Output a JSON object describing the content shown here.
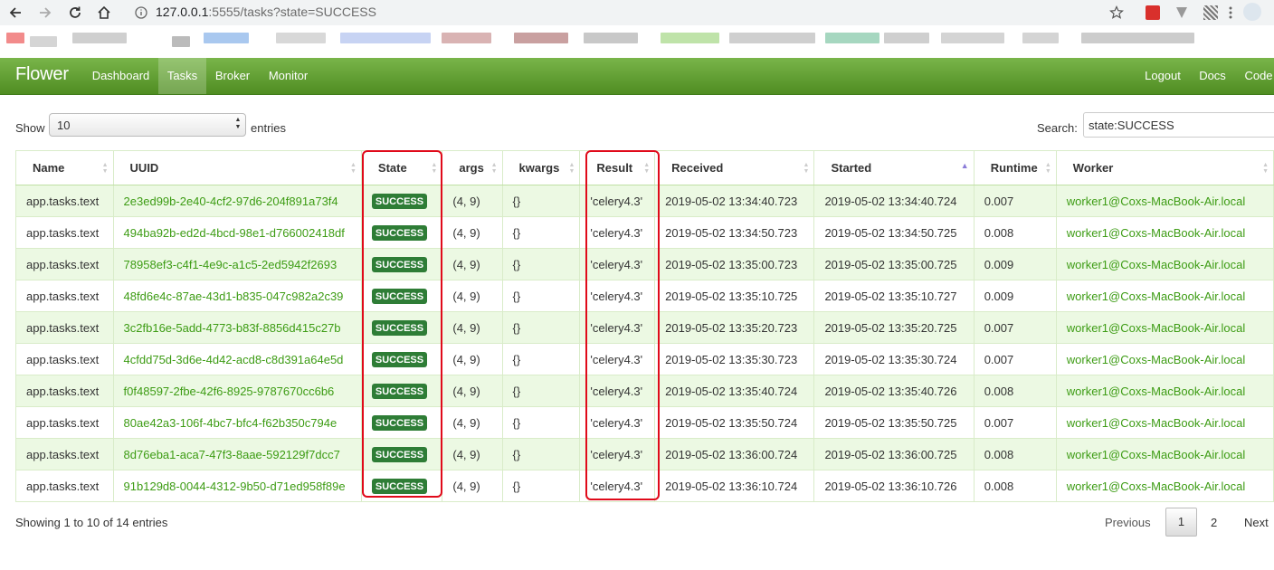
{
  "browser": {
    "url_host": "127.0.0.1",
    "url_rest": ":5555/tasks?state=SUCCESS"
  },
  "navbar": {
    "brand": "Flower",
    "links": [
      "Dashboard",
      "Tasks",
      "Broker",
      "Monitor"
    ],
    "right_links": [
      "Logout",
      "Docs",
      "Code"
    ]
  },
  "controls": {
    "show_label": "Show",
    "length_value": "10",
    "entries_label": "entries",
    "search_label": "Search:",
    "search_value": "state:SUCCESS"
  },
  "table": {
    "columns": [
      "Name",
      "UUID",
      "State",
      "args",
      "kwargs",
      "Result",
      "Received",
      "Started",
      "Runtime",
      "Worker"
    ],
    "sorted_column": "Started",
    "rows": [
      {
        "name": "app.tasks.text",
        "uuid": "2e3ed99b-2e40-4cf2-97d6-204f891a73f4",
        "state": "SUCCESS",
        "args": "(4, 9)",
        "kwargs": "{}",
        "result": "'celery4.3'",
        "received": "2019-05-02 13:34:40.723",
        "started": "2019-05-02 13:34:40.724",
        "runtime": "0.007",
        "worker": "worker1@Coxs-MacBook-Air.local"
      },
      {
        "name": "app.tasks.text",
        "uuid": "494ba92b-ed2d-4bcd-98e1-d766002418df",
        "state": "SUCCESS",
        "args": "(4, 9)",
        "kwargs": "{}",
        "result": "'celery4.3'",
        "received": "2019-05-02 13:34:50.723",
        "started": "2019-05-02 13:34:50.725",
        "runtime": "0.008",
        "worker": "worker1@Coxs-MacBook-Air.local"
      },
      {
        "name": "app.tasks.text",
        "uuid": "78958ef3-c4f1-4e9c-a1c5-2ed5942f2693",
        "state": "SUCCESS",
        "args": "(4, 9)",
        "kwargs": "{}",
        "result": "'celery4.3'",
        "received": "2019-05-02 13:35:00.723",
        "started": "2019-05-02 13:35:00.725",
        "runtime": "0.009",
        "worker": "worker1@Coxs-MacBook-Air.local"
      },
      {
        "name": "app.tasks.text",
        "uuid": "48fd6e4c-87ae-43d1-b835-047c982a2c39",
        "state": "SUCCESS",
        "args": "(4, 9)",
        "kwargs": "{}",
        "result": "'celery4.3'",
        "received": "2019-05-02 13:35:10.725",
        "started": "2019-05-02 13:35:10.727",
        "runtime": "0.009",
        "worker": "worker1@Coxs-MacBook-Air.local"
      },
      {
        "name": "app.tasks.text",
        "uuid": "3c2fb16e-5add-4773-b83f-8856d415c27b",
        "state": "SUCCESS",
        "args": "(4, 9)",
        "kwargs": "{}",
        "result": "'celery4.3'",
        "received": "2019-05-02 13:35:20.723",
        "started": "2019-05-02 13:35:20.725",
        "runtime": "0.007",
        "worker": "worker1@Coxs-MacBook-Air.local"
      },
      {
        "name": "app.tasks.text",
        "uuid": "4cfdd75d-3d6e-4d42-acd8-c8d391a64e5d",
        "state": "SUCCESS",
        "args": "(4, 9)",
        "kwargs": "{}",
        "result": "'celery4.3'",
        "received": "2019-05-02 13:35:30.723",
        "started": "2019-05-02 13:35:30.724",
        "runtime": "0.007",
        "worker": "worker1@Coxs-MacBook-Air.local"
      },
      {
        "name": "app.tasks.text",
        "uuid": "f0f48597-2fbe-42f6-8925-9787670cc6b6",
        "state": "SUCCESS",
        "args": "(4, 9)",
        "kwargs": "{}",
        "result": "'celery4.3'",
        "received": "2019-05-02 13:35:40.724",
        "started": "2019-05-02 13:35:40.726",
        "runtime": "0.008",
        "worker": "worker1@Coxs-MacBook-Air.local"
      },
      {
        "name": "app.tasks.text",
        "uuid": "80ae42a3-106f-4bc7-bfc4-f62b350c794e",
        "state": "SUCCESS",
        "args": "(4, 9)",
        "kwargs": "{}",
        "result": "'celery4.3'",
        "received": "2019-05-02 13:35:50.724",
        "started": "2019-05-02 13:35:50.725",
        "runtime": "0.007",
        "worker": "worker1@Coxs-MacBook-Air.local"
      },
      {
        "name": "app.tasks.text",
        "uuid": "8d76eba1-aca7-47f3-8aae-592129f7dcc7",
        "state": "SUCCESS",
        "args": "(4, 9)",
        "kwargs": "{}",
        "result": "'celery4.3'",
        "received": "2019-05-02 13:36:00.724",
        "started": "2019-05-02 13:36:00.725",
        "runtime": "0.008",
        "worker": "worker1@Coxs-MacBook-Air.local"
      },
      {
        "name": "app.tasks.text",
        "uuid": "91b129d8-0044-4312-9b50-d71ed958f89e",
        "state": "SUCCESS",
        "args": "(4, 9)",
        "kwargs": "{}",
        "result": "'celery4.3'",
        "received": "2019-05-02 13:36:10.724",
        "started": "2019-05-02 13:36:10.726",
        "runtime": "0.008",
        "worker": "worker1@Coxs-MacBook-Air.local"
      }
    ]
  },
  "footer": {
    "info": "Showing 1 to 10 of 14 entries",
    "previous": "Previous",
    "pages": [
      "1",
      "2"
    ],
    "current_page": "1",
    "next": "Next"
  },
  "colors": {
    "navbar_top": "#79b54a",
    "navbar_bottom": "#4f8d22",
    "link_green": "#3d9c14",
    "badge_green": "#2e7d36",
    "row_stripe": "#ecf9e3",
    "highlight_red": "#e00a1a"
  },
  "icons": [
    "back-icon",
    "forward-icon",
    "reload-icon",
    "home-icon",
    "info-icon",
    "star-icon",
    "extension-icon",
    "qr-icon",
    "menu-icon",
    "sort-icon"
  ]
}
